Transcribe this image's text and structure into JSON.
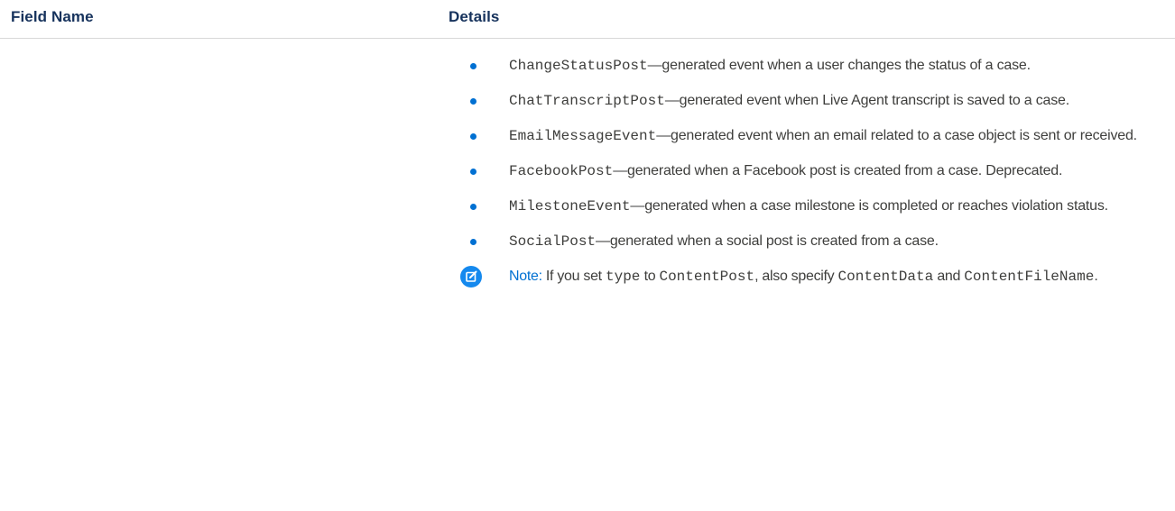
{
  "table": {
    "headers": {
      "field_name": "Field Name",
      "details": "Details"
    },
    "items": [
      {
        "code": "ChangeStatusPost",
        "text": "—generated event when a user changes the status of a case."
      },
      {
        "code": "ChatTranscriptPost",
        "text": "—generated event when Live Agent transcript is saved to a case."
      },
      {
        "code": "EmailMessageEvent",
        "text": "—generated event when an email related to a case object is sent or received."
      },
      {
        "code": "FacebookPost",
        "text": "—generated when a Facebook post is created from a case. Deprecated."
      },
      {
        "code": "MilestoneEvent",
        "text": "—generated when a case milestone is completed or reaches violation status."
      },
      {
        "code": "SocialPost",
        "text": "—generated when a social post is created from a case."
      }
    ],
    "note": {
      "label": "Note:",
      "text1": "If you set",
      "code1": "type",
      "text2": "to",
      "code2": "ContentPost",
      "text3": ", also specify",
      "code3": "ContentData",
      "text4": "and",
      "code4": "ContentFileName",
      "text5": ".",
      "icon": "edit-note-icon",
      "icon_color": "#1589ee"
    }
  },
  "colors": {
    "header_text": "#16325c",
    "bullet": "#0070d2",
    "note_label": "#0070d2",
    "body_text": "#3e3e3c",
    "divider": "#d8d8d8"
  }
}
